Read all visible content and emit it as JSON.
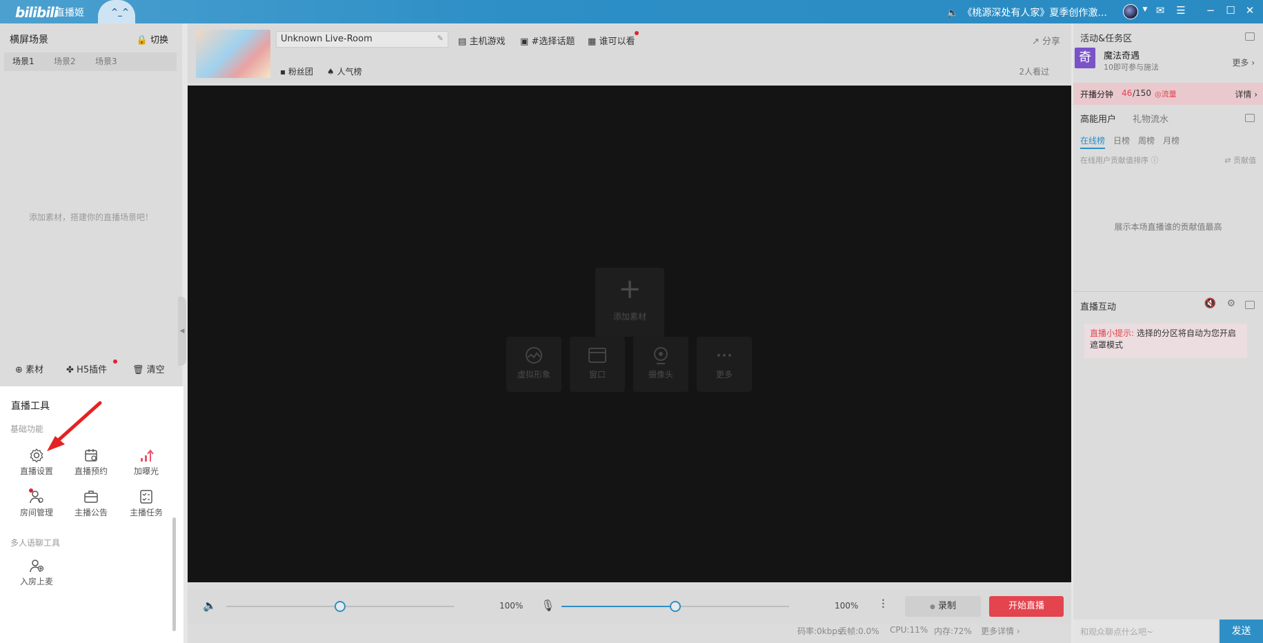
{
  "titlebar": {
    "logo": "bilibili",
    "app_name": "直播姬",
    "notice": "《桃源深处有人家》夏季创作激..."
  },
  "scenes": {
    "header": "横屏场景",
    "switch_label": "切换",
    "tabs": [
      "场景1",
      "场景2",
      "场景3"
    ],
    "empty_tip": "添加素材，搭建你的直播场景吧！"
  },
  "asset_bar": {
    "material": "素材",
    "h5_plugin": "H5插件",
    "clear": "清空"
  },
  "tools": {
    "header": "直播工具",
    "section_basic": "基础功能",
    "section_multi": "多人语聊工具",
    "items": [
      "直播设置",
      "直播预约",
      "加曝光",
      "房间管理",
      "主播公告",
      "主播任务"
    ],
    "multi_items": [
      "入房上麦"
    ]
  },
  "room": {
    "title": "Unknown Live-Room",
    "category": "主机游戏",
    "topic": "#选择话题",
    "visibility": "谁可以看",
    "share": "分享",
    "fan_club": "粉丝团",
    "popularity": "人气榜",
    "viewers": "2人看过"
  },
  "stage": {
    "add_label": "添加素材",
    "sources": [
      "虚拟形象",
      "窗口",
      "摄像头",
      "更多"
    ]
  },
  "audio": {
    "speaker_volume": "100%",
    "mic_volume": "100%",
    "speaker_level": 0.5,
    "mic_level": 0.5,
    "record": "录制",
    "start_live": "开始直播"
  },
  "status": {
    "bitrate": "码率:0kbps",
    "drop": "丢帧:0.0%",
    "cpu": "CPU:11%",
    "memory": "内存:72%",
    "more": "更多详情"
  },
  "right": {
    "activity_header": "活动&任务区",
    "activity_title": "魔法奇遇",
    "activity_sub": "10即可参与施法",
    "activity_icon": "奇",
    "more": "更多",
    "minutes_label": "开播分钟",
    "minutes_value": "46",
    "minutes_total": "/150",
    "flow_label": "流量",
    "detail": "详情",
    "tab_high": "高能用户",
    "tab_gift": "礼物流水",
    "rank_tabs": [
      "在线榜",
      "日榜",
      "周榜",
      "月榜"
    ],
    "rank_desc": "在线用户贡献值排序",
    "contribution": "贡献值",
    "rank_empty": "展示本场直播谁的贡献值最高",
    "interact_header": "直播互动",
    "tip_prefix": "直播小提示:",
    "tip_text": "选择的分区将自动为您开启遮罩模式",
    "chat_placeholder": "和观众聊点什么吧~",
    "send": "发送"
  },
  "colors": {
    "accent": "#2d8fc6",
    "live_button": "#e3444d",
    "activity_icon": "#7a53c9"
  }
}
